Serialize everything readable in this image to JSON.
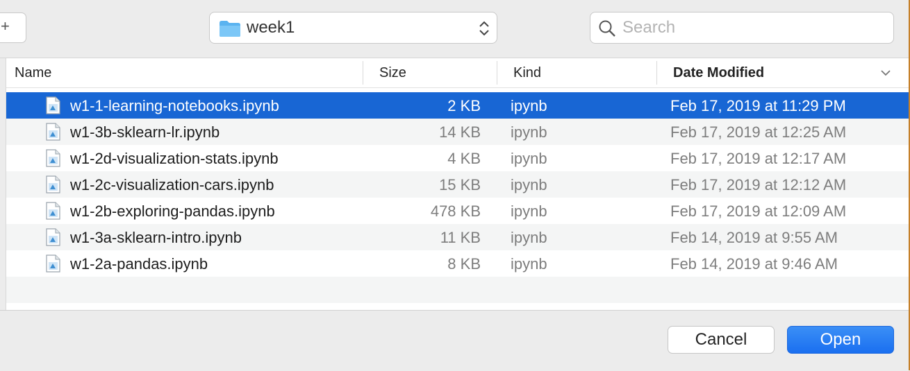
{
  "toolbar": {
    "new_folder_glyph": "+",
    "location": "week1",
    "search_placeholder": "Search"
  },
  "columns": {
    "name": "Name",
    "size": "Size",
    "kind": "Kind",
    "date": "Date Modified"
  },
  "files": [
    {
      "name": "w1-1-learning-notebooks.ipynb",
      "size": "2 KB",
      "kind": "ipynb",
      "date": "Feb 17, 2019 at 11:29 PM",
      "selected": true
    },
    {
      "name": "w1-3b-sklearn-lr.ipynb",
      "size": "14 KB",
      "kind": "ipynb",
      "date": "Feb 17, 2019 at 12:25 AM"
    },
    {
      "name": "w1-2d-visualization-stats.ipynb",
      "size": "4 KB",
      "kind": "ipynb",
      "date": "Feb 17, 2019 at 12:17 AM"
    },
    {
      "name": "w1-2c-visualization-cars.ipynb",
      "size": "15 KB",
      "kind": "ipynb",
      "date": "Feb 17, 2019 at 12:12 AM"
    },
    {
      "name": "w1-2b-exploring-pandas.ipynb",
      "size": "478 KB",
      "kind": "ipynb",
      "date": "Feb 17, 2019 at 12:09 AM"
    },
    {
      "name": "w1-3a-sklearn-intro.ipynb",
      "size": "11 KB",
      "kind": "ipynb",
      "date": "Feb 14, 2019 at 9:55 AM"
    },
    {
      "name": "w1-2a-pandas.ipynb",
      "size": "8 KB",
      "kind": "ipynb",
      "date": "Feb 14, 2019 at 9:46 AM"
    }
  ],
  "buttons": {
    "cancel": "Cancel",
    "open": "Open"
  },
  "colors": {
    "selection": "#1866d4",
    "primary_button": "#1a6ff0"
  }
}
